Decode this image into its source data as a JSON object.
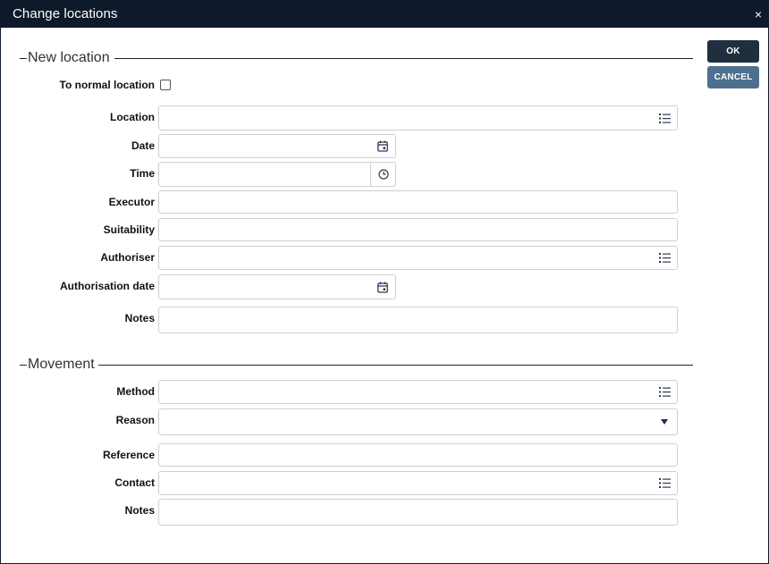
{
  "window": {
    "title": "Change locations",
    "close_glyph": "×"
  },
  "actions": {
    "ok_label": "OK",
    "cancel_label": "CANCEL"
  },
  "new_location": {
    "legend": "New location",
    "to_normal_location_label": "To normal location",
    "to_normal_location_checked": false,
    "location_label": "Location",
    "location_value": "",
    "date_label": "Date",
    "date_value": "",
    "time_label": "Time",
    "time_value": "",
    "executor_label": "Executor",
    "executor_value": "",
    "suitability_label": "Suitability",
    "suitability_value": "",
    "authoriser_label": "Authoriser",
    "authoriser_value": "",
    "authorisation_date_label": "Authorisation date",
    "authorisation_date_value": "",
    "notes_label": "Notes",
    "notes_value": ""
  },
  "movement": {
    "legend": "Movement",
    "method_label": "Method",
    "method_value": "",
    "reason_label": "Reason",
    "reason_value": "",
    "reference_label": "Reference",
    "reference_value": "",
    "contact_label": "Contact",
    "contact_value": "",
    "notes_label": "Notes",
    "notes_value": ""
  },
  "icons": {
    "list": "list-icon",
    "calendar": "calendar-icon",
    "clock": "clock-icon",
    "dropdown": "caret-down-icon",
    "close": "close-icon"
  },
  "colors": {
    "titlebar": "#0e1a2b",
    "ok_button": "#1f2f3f",
    "cancel_button": "#4f6f8f",
    "icon": "#2a3a55",
    "field_border": "#cfcfcf"
  }
}
